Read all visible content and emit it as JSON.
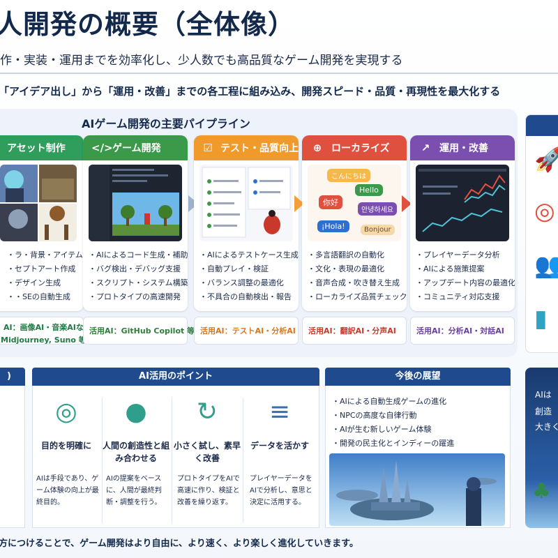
{
  "header": {
    "title": "人開発の概要（全体像）",
    "subtitle": "作・実装・運用までを効率化し、少人数でも高品質なゲーム開発を実現する",
    "lead": "「アイデア出し」から「運用・改善」までの各工程に組み込み、開発スピード・品質・再現性を最大化する"
  },
  "pipeline": {
    "title": "AIゲーム開発の主要パイプライン",
    "stages": [
      {
        "label": "アセット制作",
        "icon": "palette-icon",
        "color": "#2f9e5d",
        "items": [
          "ラ・背景・アイテム生成",
          "セプトアート作成",
          "デザイン生成",
          "・SEの自動生成"
        ],
        "ai": [
          "AI：画像AI・音楽AIなど",
          "Midjourney, Suno 等)"
        ],
        "ai_color": "#1f7a45"
      },
      {
        "label": "ゲーム開発",
        "icon": "code-icon",
        "color": "#3a9a49",
        "items": [
          "AIによるコード生成・補助",
          "バグ検出・デバッグ支援",
          "スクリプト・システム構築",
          "プロトタイプの高速開発"
        ],
        "ai": [
          "活用AI：GitHub Copilot 等"
        ],
        "ai_color": "#2f7d3a"
      },
      {
        "label": "テスト・品質向上",
        "icon": "checklist-icon",
        "color": "#ef9a2b",
        "items": [
          "AIによるテストケース生成",
          "自動プレイ・検証",
          "バランス調整の最適化",
          "不具合の自動検出・報告"
        ],
        "ai": [
          "活用AI：テストAI・分析AI"
        ],
        "ai_color": "#d9771b"
      },
      {
        "label": "ローカライズ",
        "icon": "globe-icon",
        "color": "#e0503f",
        "items": [
          "多言語翻訳の自動化",
          "文化・表現の最適化",
          "音声合成・吹き替え生成",
          "ローカライズ品質チェック"
        ],
        "ai": [
          "活用AI：翻訳AI・分声AI"
        ],
        "ai_color": "#c8392b"
      },
      {
        "label": "運用・改善",
        "icon": "chart-up-icon",
        "color": "#7a4fb0",
        "items": [
          "プレイヤーデータ分析",
          "AIによる施策提案",
          "アップデート内容の最適化",
          "コミュニティ対応支援"
        ],
        "ai": [
          "活用AI：分析AI・対話AI"
        ],
        "ai_color": "#6a3fa0"
      }
    ],
    "bubbles": [
      "こんにちは",
      "Hello",
      "你好",
      "안녕하세요",
      "¡Hola!",
      "Bonjour"
    ]
  },
  "points": {
    "left_stub": ")",
    "title": "AI活用のポイント",
    "items": [
      {
        "heading": "目的を明確に",
        "body": "AIは手段であり、ゲーム体験の向上が最終目的。",
        "icon": "target-icon"
      },
      {
        "heading": "人間の創造性と組み合わせる",
        "body": "AIの提案をベースに、人間が最終判断・調整を行う。",
        "icon": "person-icon"
      },
      {
        "heading": "小さく試し、素早く改善",
        "body": "プロトタイプをAIで高速に作り、検証と改善を繰り返す。",
        "icon": "refresh-icon"
      },
      {
        "heading": "データを活かす",
        "body": "プレイヤーデータをAIで分析し、意思と決定に活用する。",
        "icon": "database-icon"
      }
    ]
  },
  "future": {
    "title": "今後の展望",
    "items": [
      "AIによる自動生成ゲームの進化",
      "NPCの高度な自律行動",
      "AIが生む新しいゲーム体験",
      "開発の民主化とインディーの躍進"
    ]
  },
  "side": {
    "lines": [
      "AIは",
      "創造",
      "大きく"
    ]
  },
  "footer": "方につけることで、ゲーム開発はより自由に、より速く、より楽しく進化していきます。"
}
